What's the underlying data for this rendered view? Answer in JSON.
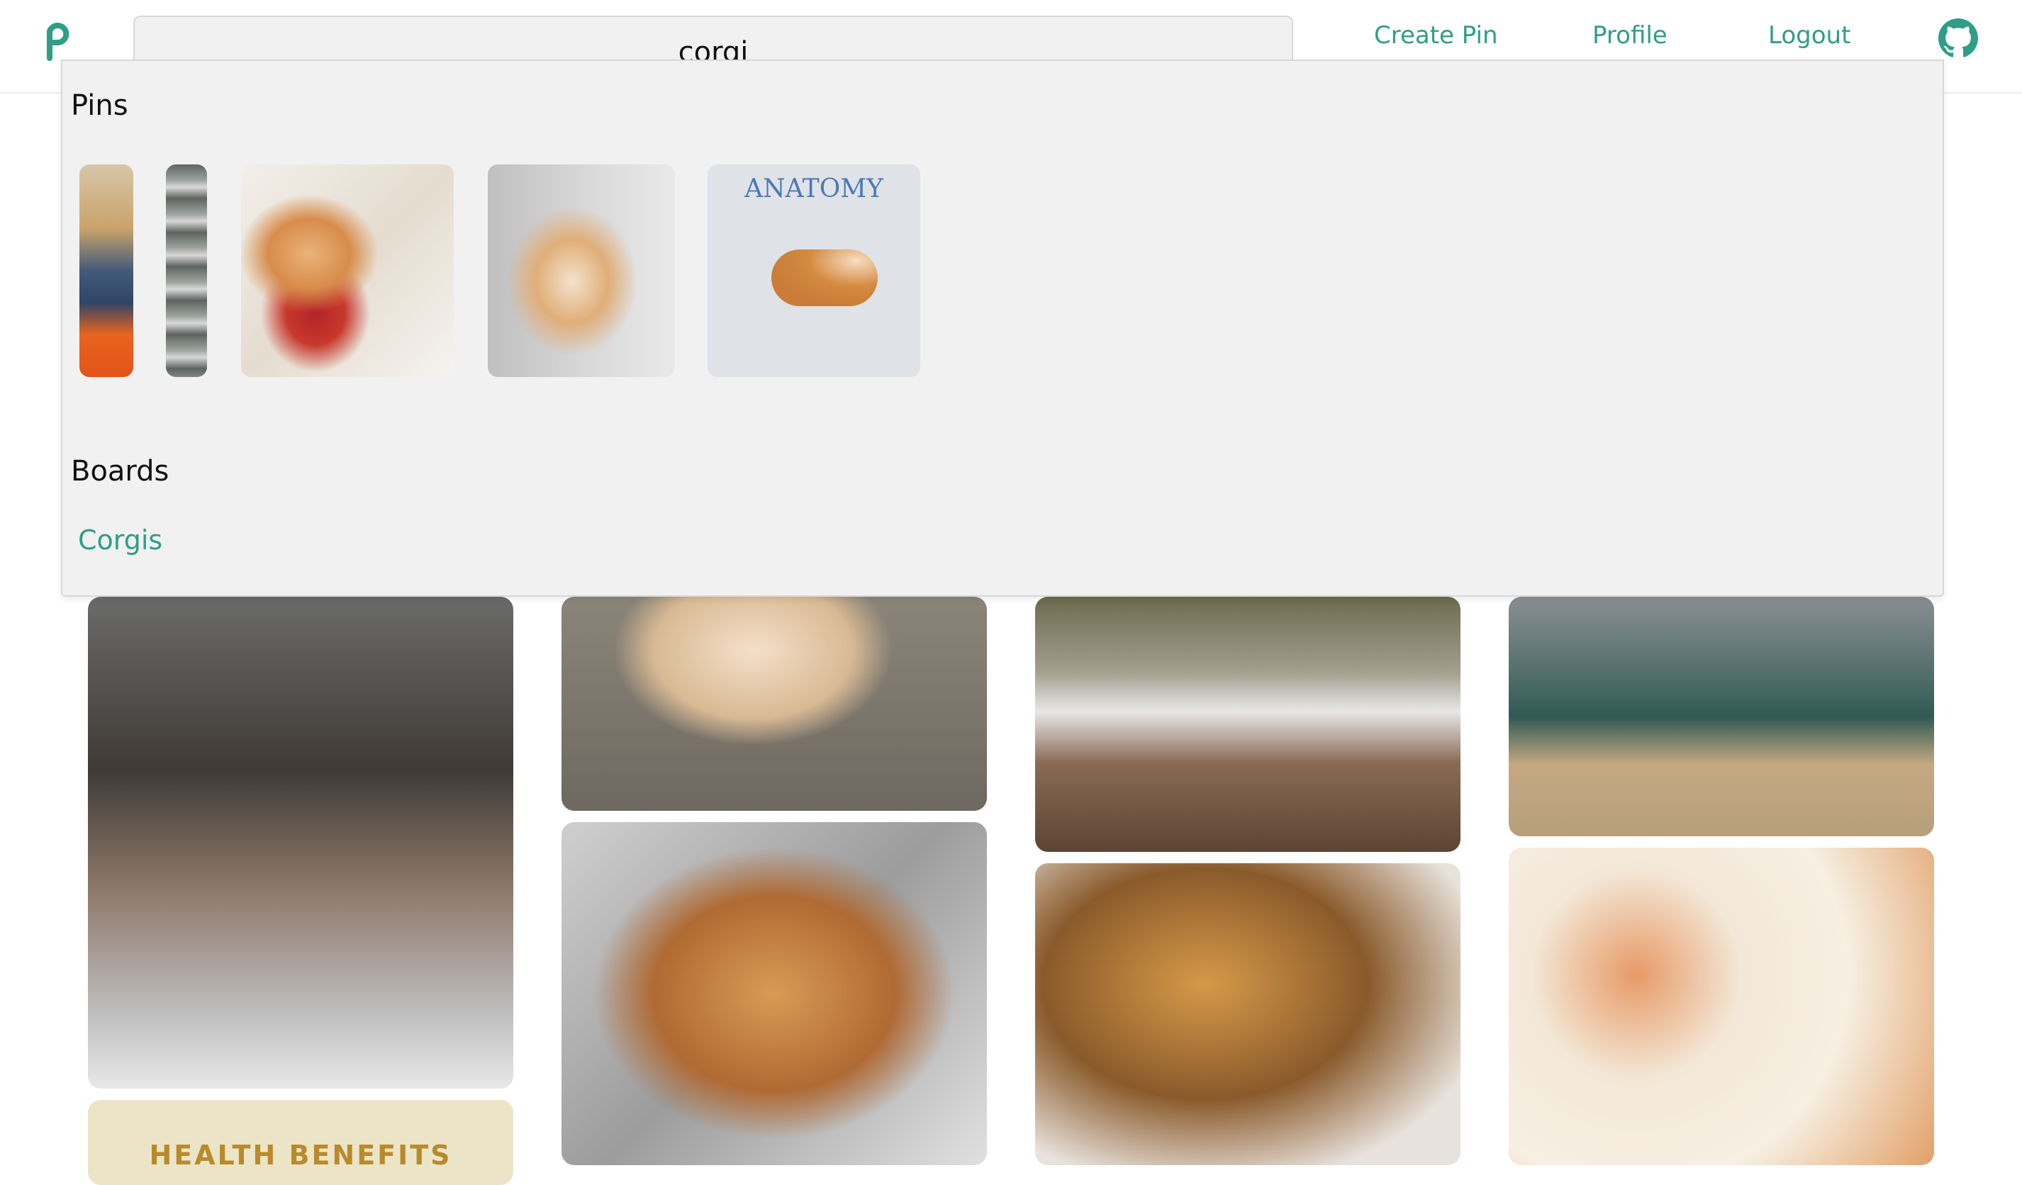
{
  "header": {
    "search_value": "corgi",
    "nav": [
      "Create Pin",
      "Profile",
      "Logout"
    ],
    "brand_color": "#2f9e86"
  },
  "dropdown": {
    "pins_heading": "Pins",
    "pins": [
      {
        "name": "corgi-collage-pin"
      },
      {
        "name": "corgi-steps-pin"
      },
      {
        "name": "corgi-harry-potter-pin"
      },
      {
        "name": "corgi-lying-pin"
      },
      {
        "name": "anatomy-of-a-corgi-pin",
        "title": "ANATOMY"
      }
    ],
    "boards_heading": "Boards",
    "boards": [
      "Corgis"
    ]
  },
  "feed": {
    "health_text": "HEALTH BENEFITS"
  },
  "icons": [
    "logo-icon",
    "github-icon"
  ]
}
